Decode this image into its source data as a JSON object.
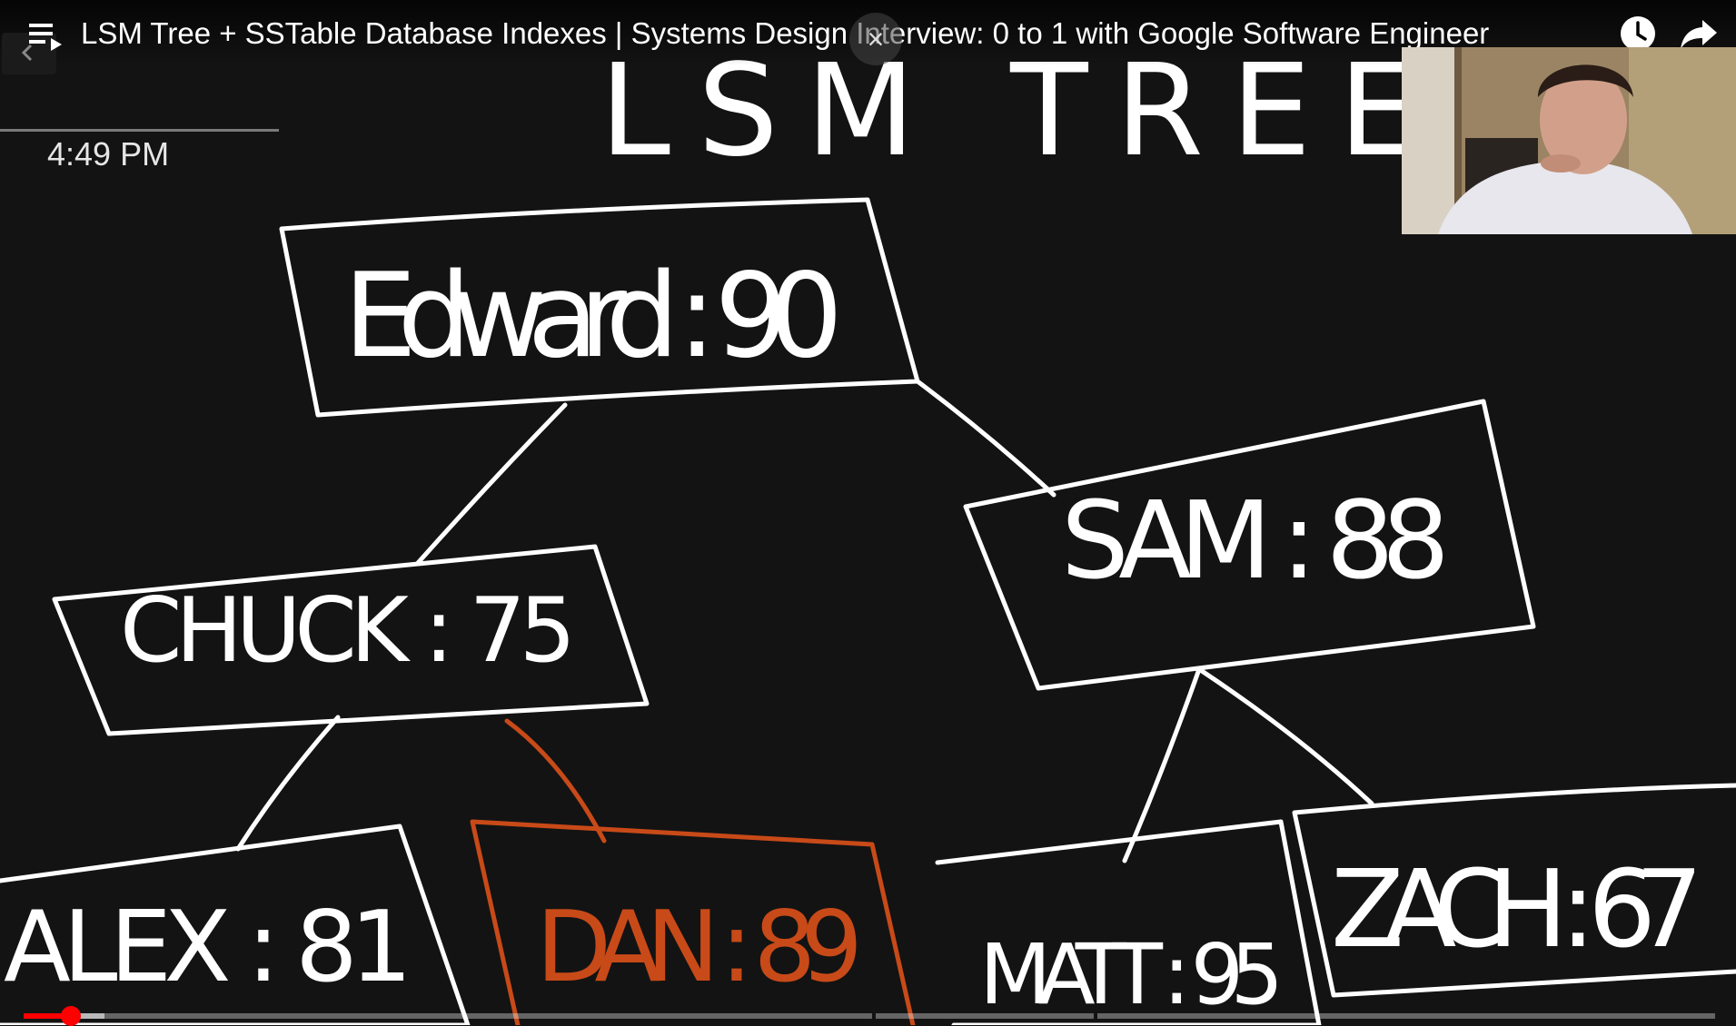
{
  "video": {
    "title": "LSM Tree + SSTable Database Indexes | Systems Design Interview: 0 to 1 with Google Software Engineer",
    "close_glyph": "×"
  },
  "overlay": {
    "time": "4:49 PM"
  },
  "whiteboard": {
    "heading": "LSM TREE",
    "root": "Edward : 90",
    "left": "CHUCK : 75",
    "right": "SAM : 88",
    "left_left": "ALEX : 81",
    "left_right_new": "DAN : 89",
    "right_left": "MATT : 95",
    "right_right": "ZACH : 67"
  },
  "player": {
    "progress_fraction": 0.028,
    "buffered_fraction": 0.048,
    "accent_color": "#ff0000"
  },
  "icons": {
    "playlist": "playlist-icon",
    "close": "close-icon",
    "watch_later": "clock-icon",
    "share": "share-icon"
  },
  "colors": {
    "chalk": "#ffffff",
    "highlight": "#c84a18",
    "board": "#131313"
  }
}
